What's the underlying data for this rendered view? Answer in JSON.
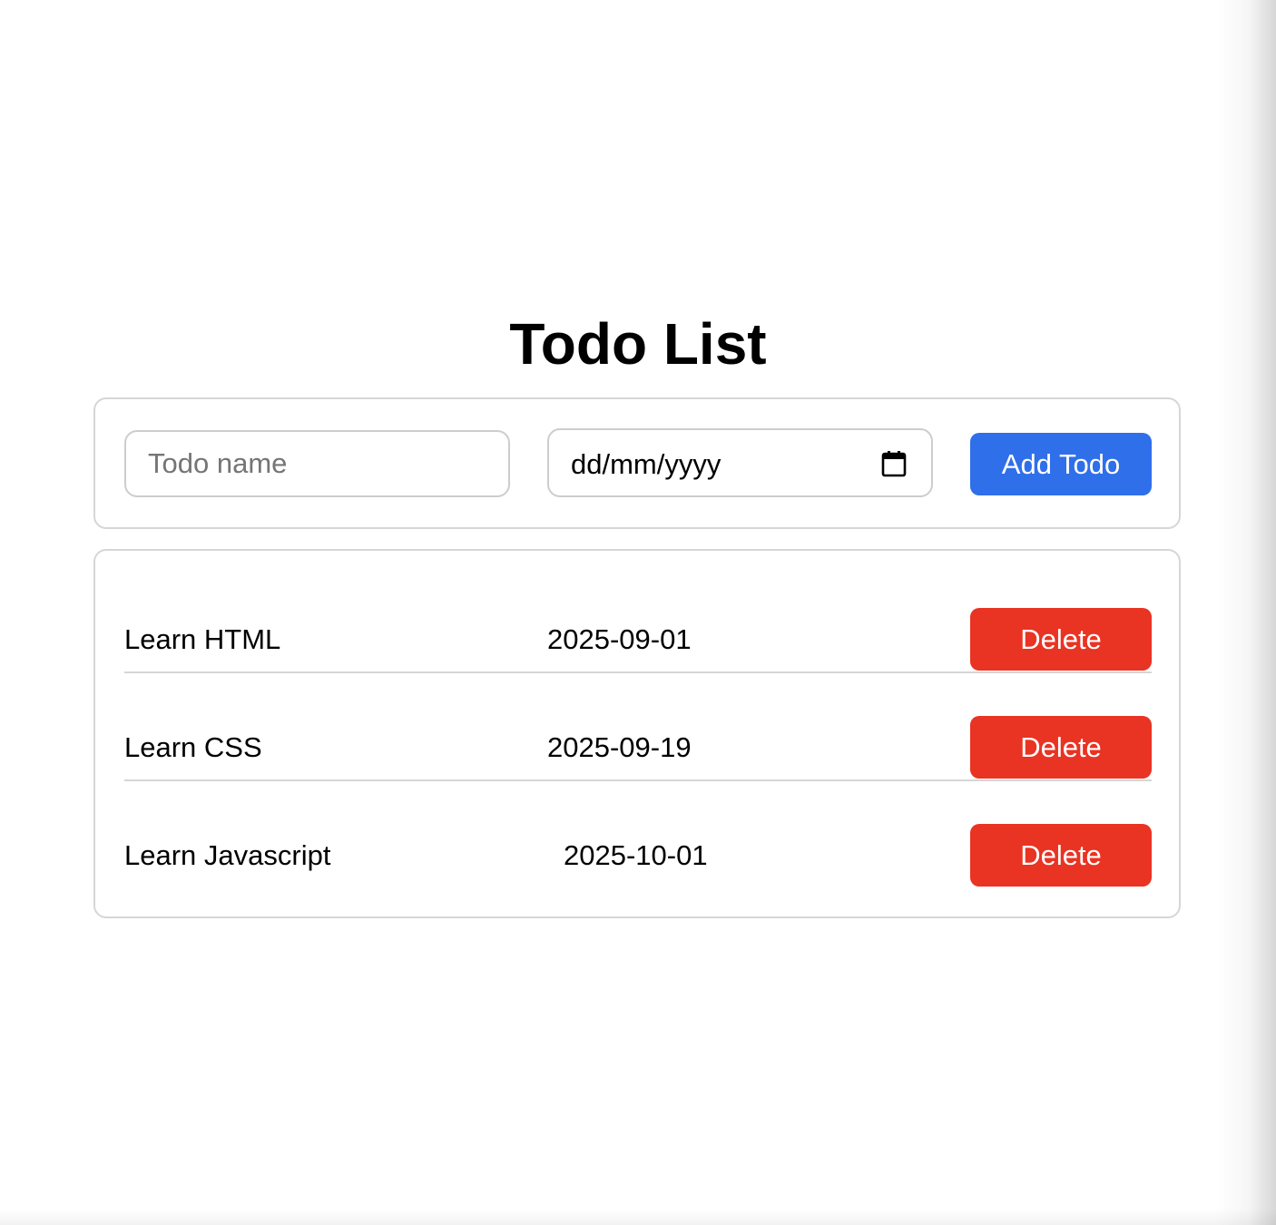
{
  "title": "Todo List",
  "form": {
    "name_placeholder": "Todo name",
    "date_placeholder": "dd/mm/yyyy",
    "add_label": "Add Todo"
  },
  "todos": [
    {
      "name": "Learn HTML",
      "date": "2025-09-01",
      "delete_label": "Delete"
    },
    {
      "name": "Learn CSS",
      "date": "2025-09-19",
      "delete_label": "Delete"
    },
    {
      "name": "Learn Javascript",
      "date": "2025-10-01",
      "delete_label": "Delete"
    }
  ],
  "colors": {
    "primary": "#2f6fea",
    "danger": "#e93323",
    "border": "#d6d6d6"
  },
  "icons": {
    "date_picker": "calendar-icon"
  }
}
